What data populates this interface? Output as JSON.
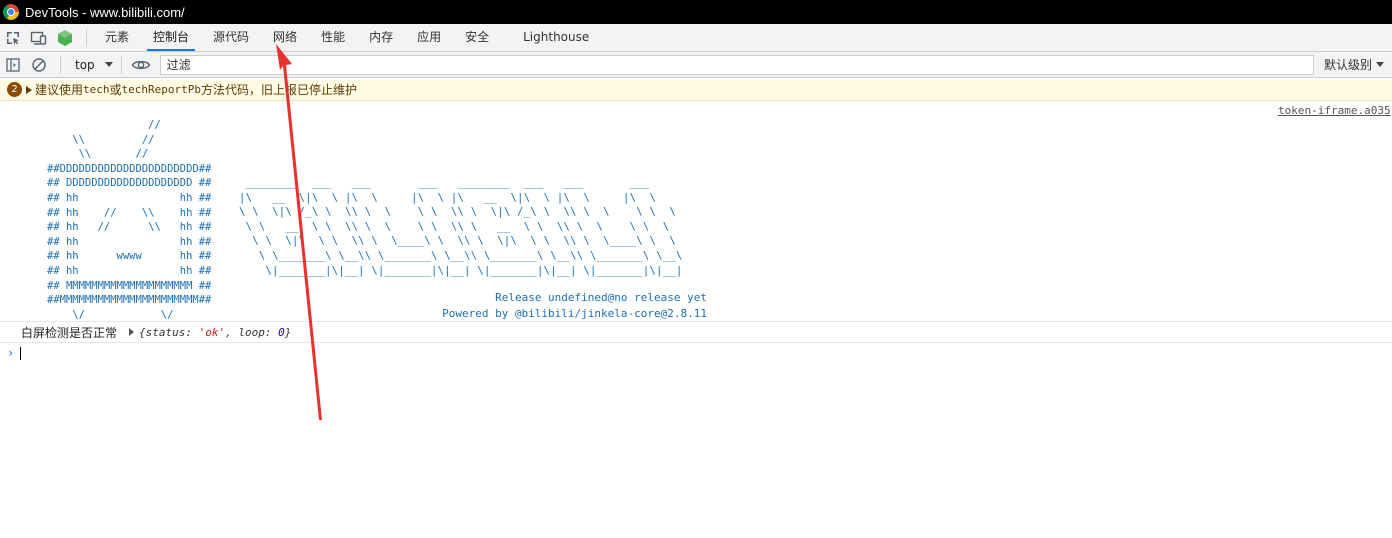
{
  "window": {
    "title": "DevTools - www.bilibili.com/"
  },
  "tabs": [
    {
      "label": "元素",
      "active": false
    },
    {
      "label": "控制台",
      "active": true
    },
    {
      "label": "源代码",
      "active": false
    },
    {
      "label": "网络",
      "active": false
    },
    {
      "label": "性能",
      "active": false
    },
    {
      "label": "内存",
      "active": false
    },
    {
      "label": "应用",
      "active": false
    },
    {
      "label": "安全",
      "active": false
    },
    {
      "label": "Lighthouse",
      "active": false
    }
  ],
  "toolbar": {
    "context": "top",
    "filter_placeholder": "过滤",
    "levels_label": "默认级别"
  },
  "warning": {
    "count": "2",
    "parts": [
      "建议使用 ",
      "tech",
      " 或 ",
      "techReportPb",
      " 方法代码，旧上报已停止维护"
    ]
  },
  "console": {
    "source_link": "token-iframe.a035",
    "ascii_left": "                //\n    \\\\         //\n     \\\\       //\n##DDDDDDDDDDDDDDDDDDDDDD##\n## DDDDDDDDDDDDDDDDDDDD ##\n## hh                hh ##\n## hh    //    \\\\    hh ##\n## hh   //      \\\\   hh ##\n## hh                hh ##\n## hh      wwww      hh ##\n## hh                hh ##\n## MMMMMMMMMMMMMMMMMMMM ##\n##MMMMMMMMMMMMMMMMMMMMMM##\n    \\/            \\/",
    "ascii_right": " ________  ___   ___       ___   ________  ___   ___       ___\n|\\   __  \\|\\  \\ |\\  \\     |\\  \\ |\\   __  \\|\\  \\ |\\  \\     |\\  \\\n\\ \\  \\|\\ /_\\ \\  \\\\ \\  \\    \\ \\  \\\\ \\  \\|\\ /_\\ \\  \\\\ \\  \\    \\ \\  \\\n \\ \\   __  \\ \\  \\\\ \\  \\    \\ \\  \\\\ \\   __  \\ \\  \\\\ \\  \\    \\ \\  \\\n  \\ \\  \\|\\  \\ \\  \\\\ \\  \\____\\ \\  \\\\ \\  \\|\\  \\ \\  \\\\ \\  \\____\\ \\  \\\n   \\ \\_______\\ \\__\\\\ \\_______\\ \\__\\\\ \\_______\\ \\__\\\\ \\_______\\ \\__\\\n    \\|_______|\\|__| \\|_______|\\|__| \\|_______|\\|__| \\|_______|\\|__|",
    "release_line": "Release undefined@no release yet",
    "powered_line": "Powered by @bilibili/jinkela-core@2.8.11",
    "log_label": "白屏检测是否正常",
    "obj_open": "{",
    "obj_key1": "status",
    "obj_sep": ": ",
    "obj_val1": "'ok'",
    "obj_comma": ", ",
    "obj_key2": "loop",
    "obj_val2": "0",
    "obj_close": "}",
    "prompt": "›"
  },
  "colors": {
    "accent": "#1a73e8",
    "annotation_arrow": "#e8322f",
    "ascii": "#1d6fb3"
  }
}
